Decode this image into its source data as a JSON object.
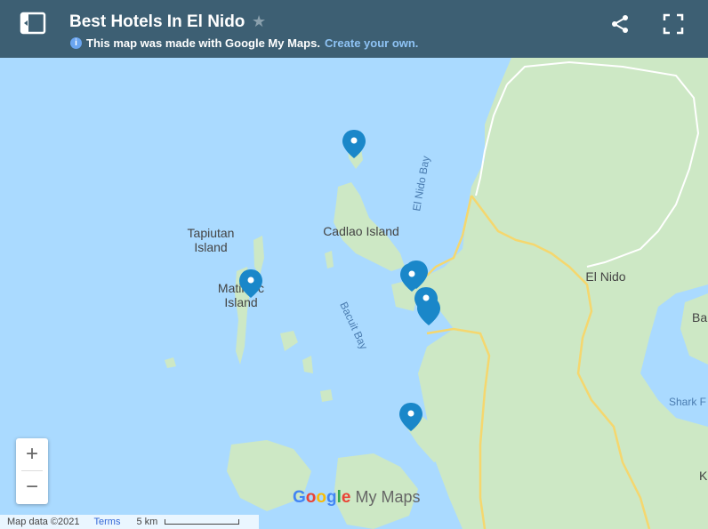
{
  "header": {
    "title": "Best Hotels In El Nido",
    "subtitle_text": "This map was made with Google My Maps.",
    "create_link": "Create your own."
  },
  "map_labels": {
    "tapiutan_1": "Tapiutan",
    "tapiutan_2": "Island",
    "cadlao": "Cadlao Island",
    "matinloc_1": "Matinloc",
    "matinloc_2": "Island",
    "el_nido_bay": "El Nido Bay",
    "bacuit_bay": "Bacuit Bay",
    "el_nido": "El Nido",
    "shark_fin": "Shark F",
    "ba": "Ba",
    "k": "K"
  },
  "footer": {
    "map_data": "Map data ©2021",
    "terms": "Terms",
    "scale": "5 km"
  },
  "logo": {
    "google": "Google",
    "my_maps": " My Maps"
  },
  "colors": {
    "water": "#aadaff",
    "land": "#cde8c5",
    "pin": "#1a87c9",
    "header": "#3d5f73",
    "road": "#f5d76e"
  },
  "icons": {
    "sidebar": "sidebar-toggle-icon",
    "star": "star-icon",
    "share": "share-icon",
    "fullscreen": "fullscreen-icon",
    "info": "info-icon",
    "pin": "map-pin-icon"
  }
}
